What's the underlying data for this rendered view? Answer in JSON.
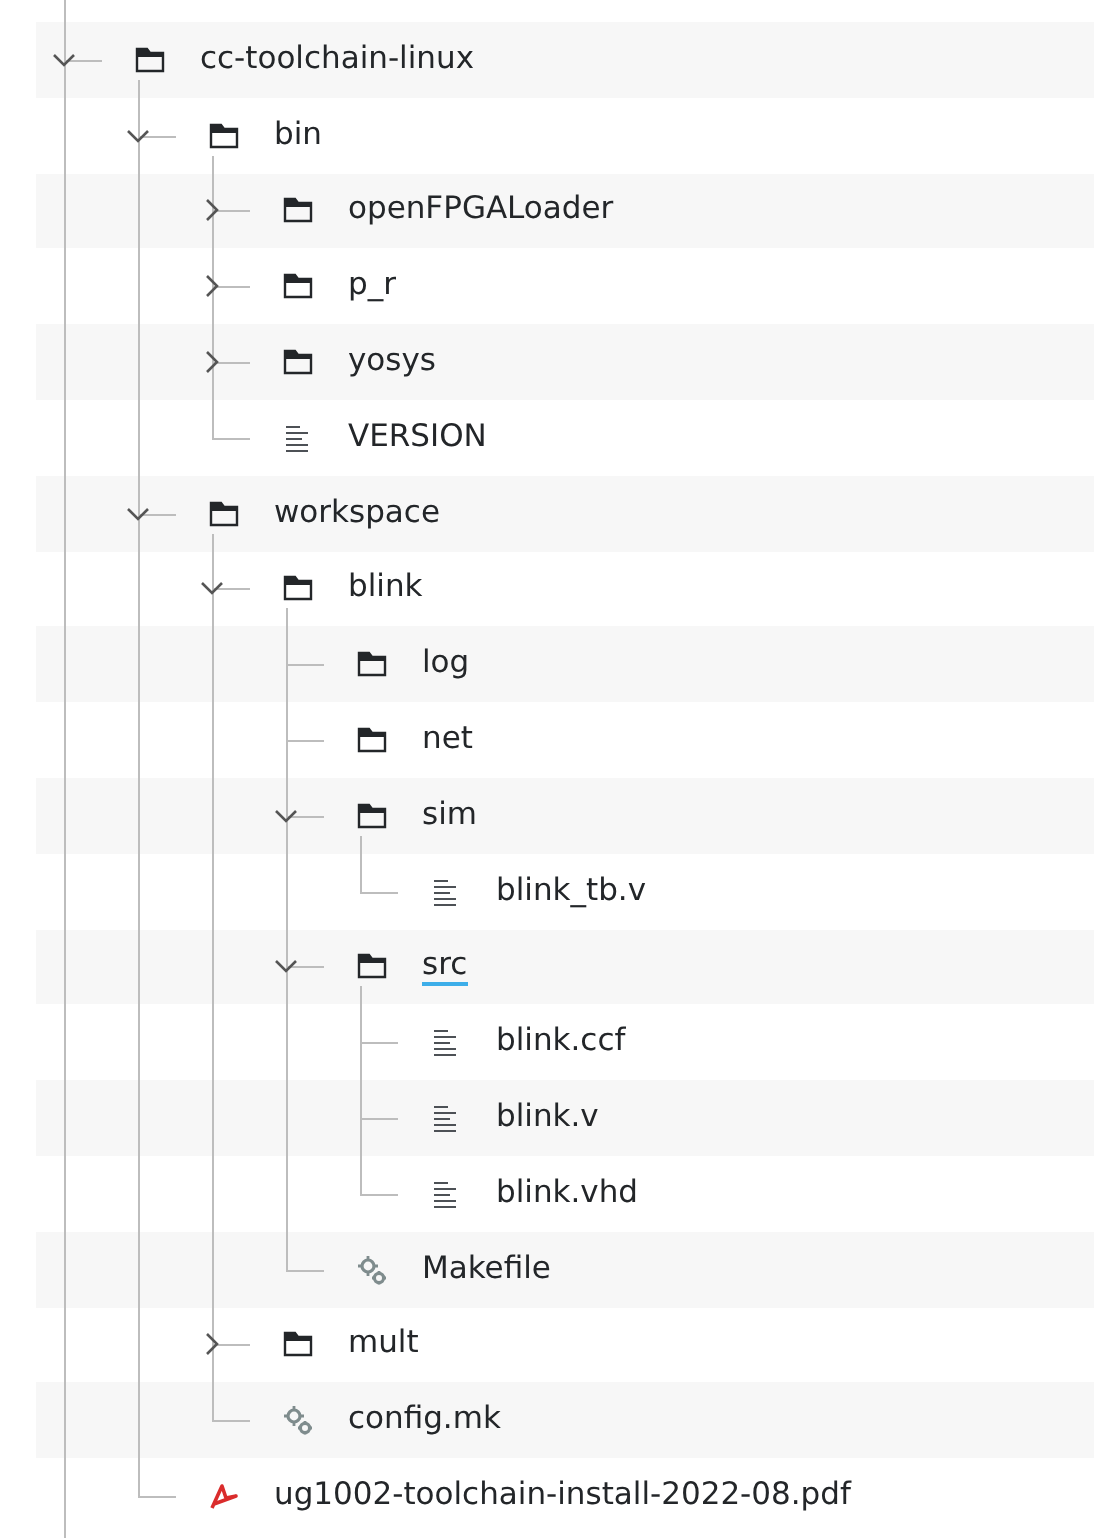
{
  "tree": [
    {
      "name": "cc-toolchain-linux",
      "kind": "folder",
      "expanded": true,
      "focused": false,
      "children": [
        {
          "name": "bin",
          "kind": "folder",
          "expanded": true,
          "focused": false,
          "children": [
            {
              "name": "openFPGALoader",
              "kind": "folder",
              "expanded": false,
              "focused": false
            },
            {
              "name": "p_r",
              "kind": "folder",
              "expanded": false,
              "focused": false
            },
            {
              "name": "yosys",
              "kind": "folder",
              "expanded": false,
              "focused": false
            },
            {
              "name": "VERSION",
              "kind": "text",
              "focused": false
            }
          ]
        },
        {
          "name": "workspace",
          "kind": "folder",
          "expanded": true,
          "focused": false,
          "children": [
            {
              "name": "blink",
              "kind": "folder",
              "expanded": true,
              "focused": false,
              "children": [
                {
                  "name": "log",
                  "kind": "folder",
                  "focused": false
                },
                {
                  "name": "net",
                  "kind": "folder",
                  "focused": false
                },
                {
                  "name": "sim",
                  "kind": "folder",
                  "expanded": true,
                  "focused": false,
                  "children": [
                    {
                      "name": "blink_tb.v",
                      "kind": "text",
                      "focused": false
                    }
                  ]
                },
                {
                  "name": "src",
                  "kind": "folder",
                  "expanded": true,
                  "focused": true,
                  "children": [
                    {
                      "name": "blink.ccf",
                      "kind": "text",
                      "focused": false
                    },
                    {
                      "name": "blink.v",
                      "kind": "text",
                      "focused": false
                    },
                    {
                      "name": "blink.vhd",
                      "kind": "text",
                      "focused": false
                    }
                  ]
                },
                {
                  "name": "Makefile",
                  "kind": "build",
                  "focused": false
                }
              ]
            },
            {
              "name": "mult",
              "kind": "folder",
              "expanded": false,
              "focused": false
            },
            {
              "name": "config.mk",
              "kind": "build",
              "focused": false
            }
          ]
        },
        {
          "name": "ug1002-toolchain-install-2022-08.pdf",
          "kind": "pdf",
          "focused": false
        }
      ]
    }
  ]
}
